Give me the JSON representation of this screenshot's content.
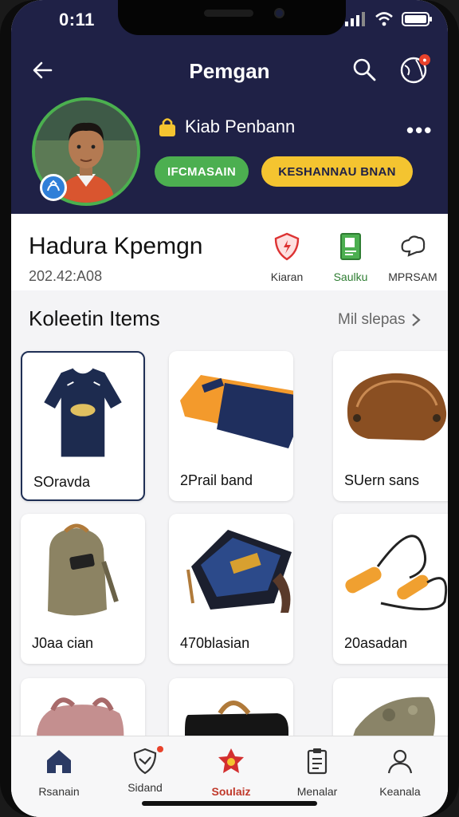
{
  "status": {
    "time": "0:11"
  },
  "header": {
    "title": "Pemgan"
  },
  "player": {
    "lock_label": "Kiab Penbann",
    "pill_green": "IFCMASAIN",
    "pill_yellow": "KESHANNAU BNAN"
  },
  "profile": {
    "name": "Hadura Kpemgn",
    "date": "202.42:A08",
    "stats": [
      {
        "label": "Kiaran",
        "color": "#333333"
      },
      {
        "label": "Saulku",
        "color": "#2e7d32"
      },
      {
        "label": "MPRSAM",
        "color": "#333333"
      }
    ]
  },
  "section": {
    "title": "Koleetin Items",
    "more": "Mil slepas"
  },
  "items": [
    {
      "label": "SOravda"
    },
    {
      "label": "2Prail band"
    },
    {
      "label": "SUern sans"
    },
    {
      "label": "J0aa cian"
    },
    {
      "label": "470blasian"
    },
    {
      "label": "20asadan"
    },
    {
      "label": ""
    },
    {
      "label": ""
    },
    {
      "label": ""
    }
  ],
  "tabs": [
    {
      "label": "Rsanain",
      "icon": "home-icon"
    },
    {
      "label": "Sidand",
      "icon": "shield-icon"
    },
    {
      "label": "Soulaiz",
      "icon": "star-icon"
    },
    {
      "label": "Menalar",
      "icon": "clipboard-icon"
    },
    {
      "label": "Keanala",
      "icon": "profile-icon"
    }
  ],
  "colors": {
    "header": "#1f2146",
    "green": "#4caf50",
    "yellow": "#f4c430",
    "accent": "#c0392b"
  }
}
